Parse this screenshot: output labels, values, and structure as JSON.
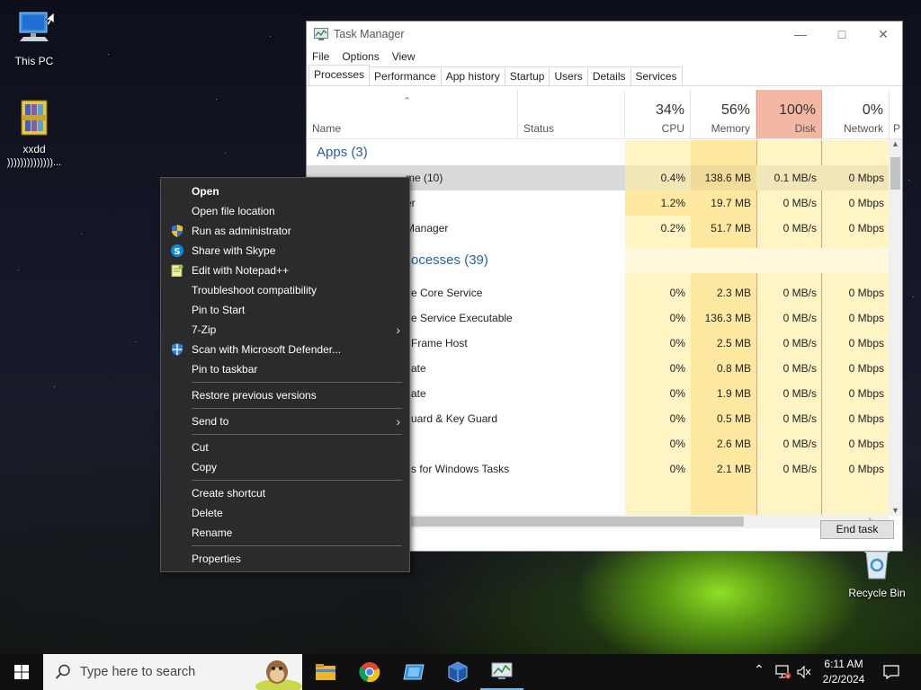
{
  "desktop": {
    "icons": [
      {
        "label": "This PC"
      },
      {
        "label": "xxdd",
        "sublabel": "))))))))))))))..."
      },
      {
        "label": "Recycle Bin"
      }
    ]
  },
  "task_manager": {
    "title": "Task Manager",
    "menu": [
      "File",
      "Options",
      "View"
    ],
    "tabs": [
      "Processes",
      "Performance",
      "App history",
      "Startup",
      "Users",
      "Details",
      "Services"
    ],
    "active_tab": "Processes",
    "columns": {
      "name": "Name",
      "status": "Status",
      "cpu": {
        "pct": "34%",
        "label": "CPU"
      },
      "memory": {
        "pct": "56%",
        "label": "Memory"
      },
      "disk": {
        "pct": "100%",
        "label": "Disk"
      },
      "network": {
        "pct": "0%",
        "label": "Network"
      },
      "power": "P"
    },
    "rows": [
      {
        "type": "group",
        "name": "Apps (3)"
      },
      {
        "type": "proc",
        "name": "me (10)",
        "cpu": "0.4%",
        "mem": "138.6 MB",
        "disk": "0.1 MB/s",
        "net": "0 Mbps",
        "selected": true
      },
      {
        "type": "proc",
        "name": "er",
        "cpu": "1.2%",
        "mem": "19.7 MB",
        "disk": "0 MB/s",
        "net": "0 Mbps"
      },
      {
        "type": "proc",
        "name": "Manager",
        "cpu": "0.2%",
        "mem": "51.7 MB",
        "disk": "0 MB/s",
        "net": "0 Mbps"
      },
      {
        "type": "group",
        "name": "ocesses (39)"
      },
      {
        "type": "proc",
        "name": "e Core Service",
        "cpu": "0%",
        "mem": "2.3 MB",
        "disk": "0 MB/s",
        "net": "0 Mbps"
      },
      {
        "type": "proc",
        "name": "e Service Executable",
        "cpu": "0%",
        "mem": "136.3 MB",
        "disk": "0 MB/s",
        "net": "0 Mbps"
      },
      {
        "type": "proc",
        "name": "Frame Host",
        "cpu": "0%",
        "mem": "2.5 MB",
        "disk": "0 MB/s",
        "net": "0 Mbps"
      },
      {
        "type": "proc",
        "name": "ate",
        "cpu": "0%",
        "mem": "0.8 MB",
        "disk": "0 MB/s",
        "net": "0 Mbps"
      },
      {
        "type": "proc",
        "name": "ate",
        "cpu": "0%",
        "mem": "1.9 MB",
        "disk": "0 MB/s",
        "net": "0 Mbps"
      },
      {
        "type": "proc",
        "name": "uard & Key Guard",
        "cpu": "0%",
        "mem": "0.5 MB",
        "disk": "0 MB/s",
        "net": "0 Mbps"
      },
      {
        "type": "proc",
        "name": "",
        "cpu": "0%",
        "mem": "2.6 MB",
        "disk": "0 MB/s",
        "net": "0 Mbps"
      },
      {
        "type": "proc",
        "name": "s for Windows Tasks",
        "cpu": "0%",
        "mem": "2.1 MB",
        "disk": "0 MB/s",
        "net": "0 Mbps"
      }
    ],
    "end_task_label": "End task"
  },
  "context_menu": {
    "items": [
      {
        "label": "Open",
        "bold": true
      },
      {
        "label": "Open file location"
      },
      {
        "label": "Run as administrator",
        "icon": "uac-shield-icon"
      },
      {
        "label": "Share with Skype",
        "icon": "skype-icon"
      },
      {
        "label": "Edit with Notepad++",
        "icon": "notepadpp-icon"
      },
      {
        "label": "Troubleshoot compatibility"
      },
      {
        "label": "Pin to Start"
      },
      {
        "label": "7-Zip",
        "submenu": true
      },
      {
        "label": "Scan with Microsoft Defender...",
        "icon": "defender-icon"
      },
      {
        "label": "Pin to taskbar"
      },
      {
        "separator": true
      },
      {
        "label": "Restore previous versions"
      },
      {
        "separator": true
      },
      {
        "label": "Send to",
        "submenu": true
      },
      {
        "separator": true
      },
      {
        "label": "Cut"
      },
      {
        "label": "Copy"
      },
      {
        "separator": true
      },
      {
        "label": "Create shortcut"
      },
      {
        "label": "Delete"
      },
      {
        "label": "Rename"
      },
      {
        "separator": true
      },
      {
        "label": "Properties"
      }
    ]
  },
  "taskbar": {
    "search_placeholder": "Type here to search",
    "apps": [
      "file-explorer-icon",
      "chrome-icon",
      "app-icon",
      "virtualbox-icon",
      "task-manager-icon"
    ],
    "time": "6:11 AM",
    "date": "2/2/2024"
  },
  "colors": {
    "menu_bg": "#2b2b2b",
    "disk_highlight": "#f4b7a4",
    "usage_light": "#fff4c4",
    "usage_medium": "#ffe8a0",
    "group_text": "#2a5ea8"
  }
}
